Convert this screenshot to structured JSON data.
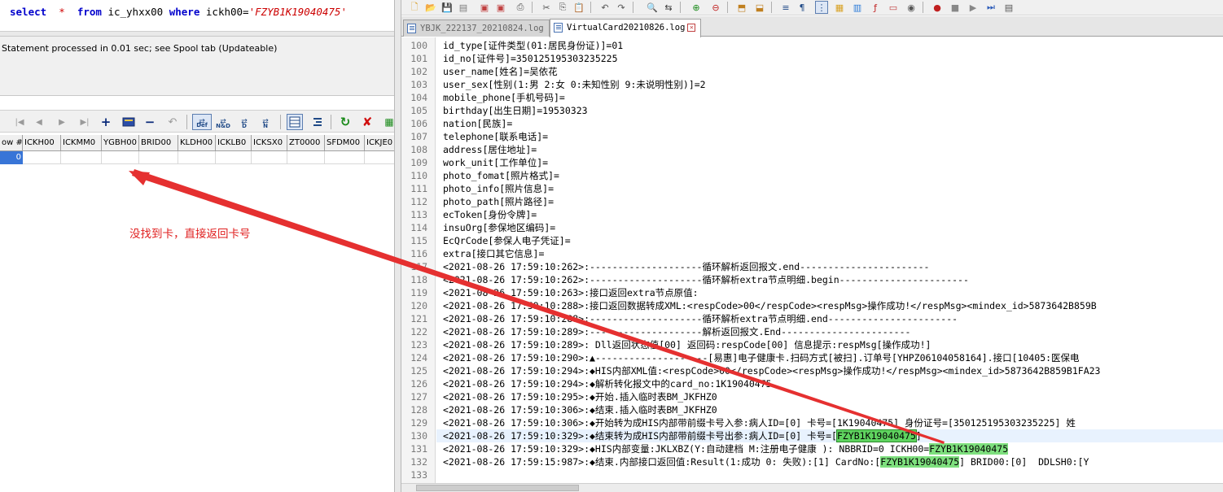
{
  "sql": {
    "kw_select": "select",
    "star": "*",
    "kw_from": "from",
    "table": "ic_yhxx00",
    "kw_where": "where",
    "condition": "ickh00=",
    "literal": "'FZYB1K19040475'"
  },
  "status": {
    "message": "Statement processed in 0.01 sec; see Spool tab (Updateable)"
  },
  "grid": {
    "columns": [
      "ow #",
      "ICKH00",
      "ICKMM0",
      "YGBH00",
      "BRID00",
      "KLDH00",
      "ICKLB0",
      "ICKSX0",
      "ZT0000",
      "SFDM00",
      "ICKJE0"
    ],
    "row_index": "0",
    "toolbar_labels": {
      "def": "Def",
      "nd": "N&D",
      "d": "D",
      "n": "N"
    }
  },
  "annotation": {
    "text": "没找到卡，直接返回卡号",
    "color": "#e02020"
  },
  "tabs": [
    {
      "label": "YBJK_222137_20210824.log",
      "active": false
    },
    {
      "label": "VirtualCard20210826.log",
      "active": true
    }
  ],
  "highlight_color": "#7ee07e",
  "lines": [
    {
      "n": "100",
      "parts": [
        {
          "t": "id_type[证件类型(01:居民身份证)]=01"
        }
      ]
    },
    {
      "n": "101",
      "parts": [
        {
          "t": "id_no[证件号]=350125195303235225"
        }
      ]
    },
    {
      "n": "102",
      "parts": [
        {
          "t": "user_name[姓名]=吴依花"
        }
      ]
    },
    {
      "n": "103",
      "parts": [
        {
          "t": "user_sex[性别(1:男 2:女 0:未知性别 9:未说明性别)]=2"
        }
      ]
    },
    {
      "n": "104",
      "parts": [
        {
          "t": "mobile_phone[手机号码]="
        }
      ]
    },
    {
      "n": "105",
      "parts": [
        {
          "t": "birthday[出生日期]=19530323"
        }
      ]
    },
    {
      "n": "106",
      "parts": [
        {
          "t": "nation[民族]="
        }
      ]
    },
    {
      "n": "107",
      "parts": [
        {
          "t": "telephone[联系电话]="
        }
      ]
    },
    {
      "n": "108",
      "parts": [
        {
          "t": "address[居住地址]="
        }
      ]
    },
    {
      "n": "109",
      "parts": [
        {
          "t": "work_unit[工作单位]="
        }
      ]
    },
    {
      "n": "110",
      "parts": [
        {
          "t": "photo_fomat[照片格式]="
        }
      ]
    },
    {
      "n": "111",
      "parts": [
        {
          "t": "photo_info[照片信息]="
        }
      ]
    },
    {
      "n": "112",
      "parts": [
        {
          "t": "photo_path[照片路径]="
        }
      ]
    },
    {
      "n": "113",
      "parts": [
        {
          "t": "ecToken[身份令牌]="
        }
      ]
    },
    {
      "n": "114",
      "parts": [
        {
          "t": "insuOrg[参保地区编码]="
        }
      ]
    },
    {
      "n": "115",
      "parts": [
        {
          "t": "EcQrCode[参保人电子凭证]="
        }
      ]
    },
    {
      "n": "116",
      "parts": [
        {
          "t": "extra[接口其它信息]="
        }
      ]
    },
    {
      "n": "117",
      "parts": [
        {
          "t": "<2021-08-26 17:59:10:262>:--------------------循环解析返回报文.end-----------------------"
        }
      ]
    },
    {
      "n": "118",
      "parts": [
        {
          "t": "<2021-08-26 17:59:10:262>:--------------------循环解析extra节点明细.begin-----------------------"
        }
      ]
    },
    {
      "n": "119",
      "parts": [
        {
          "t": "<2021-08-26 17:59:10:263>:接口返回extra节点原值:"
        }
      ]
    },
    {
      "n": "120",
      "parts": [
        {
          "t": "<2021-08-26 17:59:10:288>:接口返回数据转成XML:<respCode>00</respCode><respMsg>操作成功!</respMsg><mindex_id>5873642B859B"
        }
      ]
    },
    {
      "n": "121",
      "parts": [
        {
          "t": "<2021-08-26 17:59:10:288>:--------------------循环解析extra节点明细.end-----------------------"
        }
      ]
    },
    {
      "n": "122",
      "parts": [
        {
          "t": "<2021-08-26 17:59:10:289>:--------------------解析返回报文.End-----------------------"
        }
      ]
    },
    {
      "n": "123",
      "parts": [
        {
          "t": "<2021-08-26 17:59:10:289>: Dll返回状态值[00] 返回码:respCode[00] 信息提示:respMsg[操作成功!]"
        }
      ]
    },
    {
      "n": "124",
      "parts": [
        {
          "t": "<2021-08-26 17:59:10:290>:▲--------------------[易惠]电子健康卡.扫码方式[被扫].订单号[YHPZ06104058164].接口[10405:医保电"
        }
      ]
    },
    {
      "n": "125",
      "parts": [
        {
          "t": "<2021-08-26 17:59:10:294>:◆HIS内部XML值:<respCode>00</respCode><respMsg>操作成功!</respMsg><mindex_id>5873642B859B1FA23"
        }
      ]
    },
    {
      "n": "126",
      "parts": [
        {
          "t": "<2021-08-26 17:59:10:294>:◆解析转化报文中的card_no:1K19040475"
        }
      ]
    },
    {
      "n": "127",
      "parts": [
        {
          "t": "<2021-08-26 17:59:10:295>:◆开始.插入临时表BM_JKFHZ0"
        }
      ]
    },
    {
      "n": "128",
      "parts": [
        {
          "t": "<2021-08-26 17:59:10:306>:◆结束.插入临时表BM_JKFHZ0"
        }
      ]
    },
    {
      "n": "129",
      "parts": [
        {
          "t": "<2021-08-26 17:59:10:306>:◆开始转为成HIS内部带前缀卡号入参:病人ID=[0] 卡号=[1K19040475] 身份证号=[350125195303235225] 姓"
        }
      ]
    },
    {
      "n": "130",
      "current": true,
      "parts": [
        {
          "t": "<2021-08-26 17:59:10:329>:◆结束转为成HIS内部带前缀卡号出参:病人ID=[0] 卡号=["
        },
        {
          "t": "FZYB1K19040475",
          "h": "sel"
        },
        {
          "t": "]"
        }
      ]
    },
    {
      "n": "131",
      "parts": [
        {
          "t": "<2021-08-26 17:59:10:329>:◆HIS内部变量:JKLXBZ(Y:自动建档 M:注册电子健康 ): NBBRID=0 ICKH00="
        },
        {
          "t": "FZYB1K19040475",
          "h": "hl"
        }
      ]
    },
    {
      "n": "132",
      "parts": [
        {
          "t": "<2021-08-26 17:59:15:987>:◆结束.内部接口返回值:Result(1:成功 0: 失败):[1] CardNo:["
        },
        {
          "t": "FZYB1K19040475",
          "h": "hl"
        },
        {
          "t": "] BRID00:[0]  DDLSH0:[Y"
        }
      ]
    },
    {
      "n": "133",
      "parts": [
        {
          "t": ""
        }
      ]
    }
  ]
}
